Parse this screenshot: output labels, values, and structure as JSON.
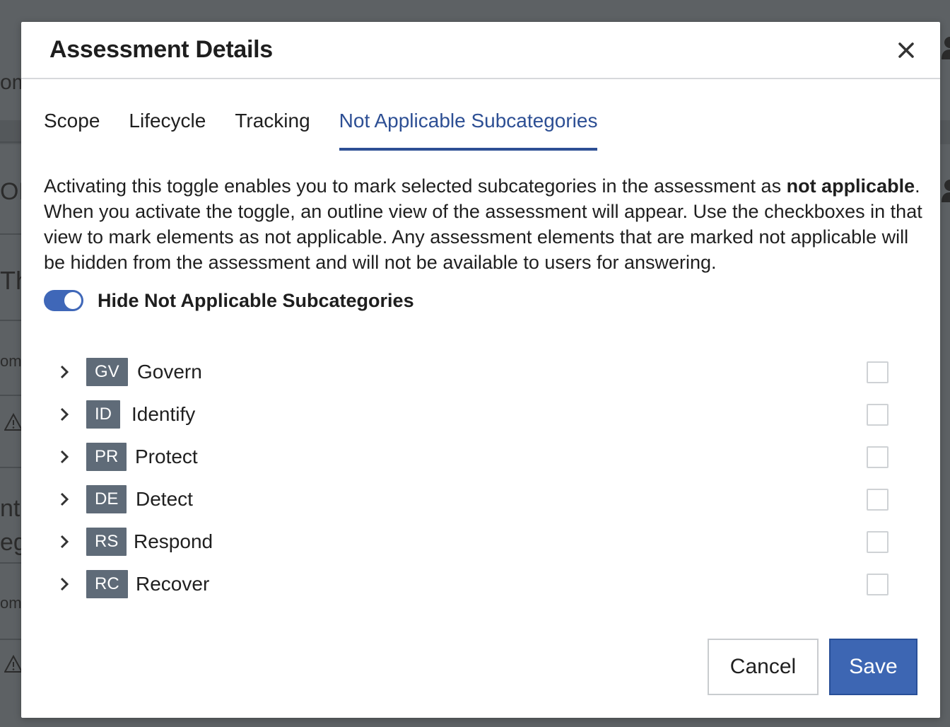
{
  "background": {
    "fragments": [
      "om",
      "ORY",
      "The",
      "om",
      "nt",
      "eg",
      "om"
    ]
  },
  "modal": {
    "title": "Assessment Details",
    "close_icon": "close-icon"
  },
  "tabs": [
    {
      "label": "Scope",
      "active": false
    },
    {
      "label": "Lifecycle",
      "active": false
    },
    {
      "label": "Tracking",
      "active": false
    },
    {
      "label": "Not Applicable Subcategories",
      "active": true
    }
  ],
  "description": {
    "part1": "Activating this toggle enables you to mark selected subcategories in the assessment as ",
    "bold": "not applicable",
    "part2": ". When you activate the toggle, an outline view of the assessment will appear. Use the checkboxes in that view to mark elements as not applicable. Any assessment elements that are marked not applicable will be hidden from the assessment and will not be available to users for answering."
  },
  "toggle": {
    "label": "Hide Not Applicable Subcategories",
    "on": true
  },
  "categories": [
    {
      "code": "GV",
      "label": "Govern",
      "checked": false
    },
    {
      "code": "ID",
      "label": "Identify",
      "checked": false
    },
    {
      "code": "PR",
      "label": "Protect",
      "checked": false
    },
    {
      "code": "DE",
      "label": "Detect",
      "checked": false
    },
    {
      "code": "RS",
      "label": "Respond",
      "checked": false
    },
    {
      "code": "RC",
      "label": "Recover",
      "checked": false
    }
  ],
  "buttons": {
    "cancel": "Cancel",
    "save": "Save"
  },
  "colors": {
    "accent": "#2d4f94",
    "save_button": "#3d66b3",
    "badge": "#5f6b78",
    "overlay": "#5f6366"
  }
}
